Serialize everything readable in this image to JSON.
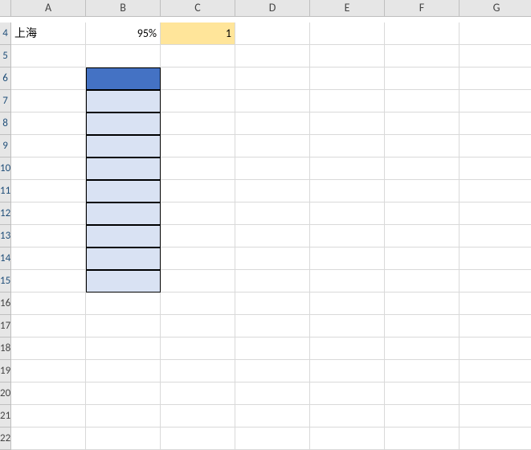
{
  "columns": [
    "A",
    "B",
    "C",
    "D",
    "E",
    "F",
    "G"
  ],
  "rows": [
    "4",
    "5",
    "6",
    "7",
    "8",
    "9",
    "10",
    "11",
    "12",
    "13",
    "14",
    "15",
    "16",
    "17",
    "18",
    "19",
    "20",
    "21",
    "22"
  ],
  "cells": {
    "A4": "上海",
    "B4": "95%",
    "C4": "1"
  }
}
